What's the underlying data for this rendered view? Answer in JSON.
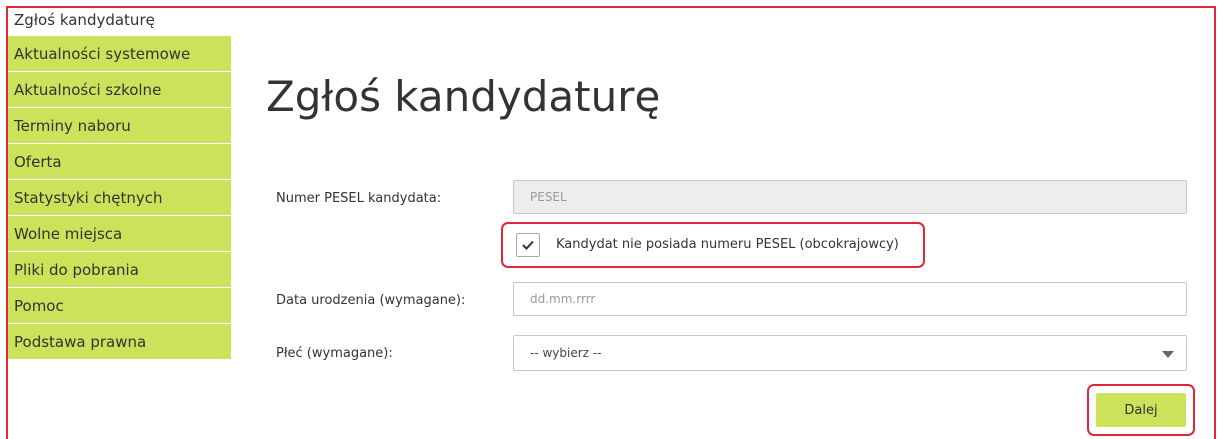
{
  "sidebar": {
    "items": [
      {
        "label": "Zgłoś kandydaturę",
        "active": true
      },
      {
        "label": "Aktualności systemowe"
      },
      {
        "label": "Aktualności szkolne"
      },
      {
        "label": "Terminy naboru"
      },
      {
        "label": "Oferta"
      },
      {
        "label": "Statystyki chętnych"
      },
      {
        "label": "Wolne miejsca"
      },
      {
        "label": "Pliki do pobrania"
      },
      {
        "label": "Pomoc"
      },
      {
        "label": "Podstawa prawna"
      }
    ]
  },
  "main": {
    "title": "Zgłoś kandydaturę",
    "form": {
      "pesel": {
        "label": "Numer PESEL kandydata:",
        "value": "",
        "placeholder": "PESEL",
        "disabled": true
      },
      "no_pesel": {
        "label": "Kandydat nie posiada numeru PESEL (obcokrajowcy)",
        "checked": true
      },
      "birth_date": {
        "label": "Data urodzenia (wymagane):",
        "value": "",
        "placeholder": "dd.mm.rrrr"
      },
      "gender": {
        "label": "Płeć (wymagane):",
        "selected": "-- wybierz --"
      },
      "next_button": {
        "label": "Dalej"
      }
    }
  },
  "colors": {
    "accent": "#cbe35a",
    "highlight": "#e0283a",
    "text": "#333333"
  }
}
